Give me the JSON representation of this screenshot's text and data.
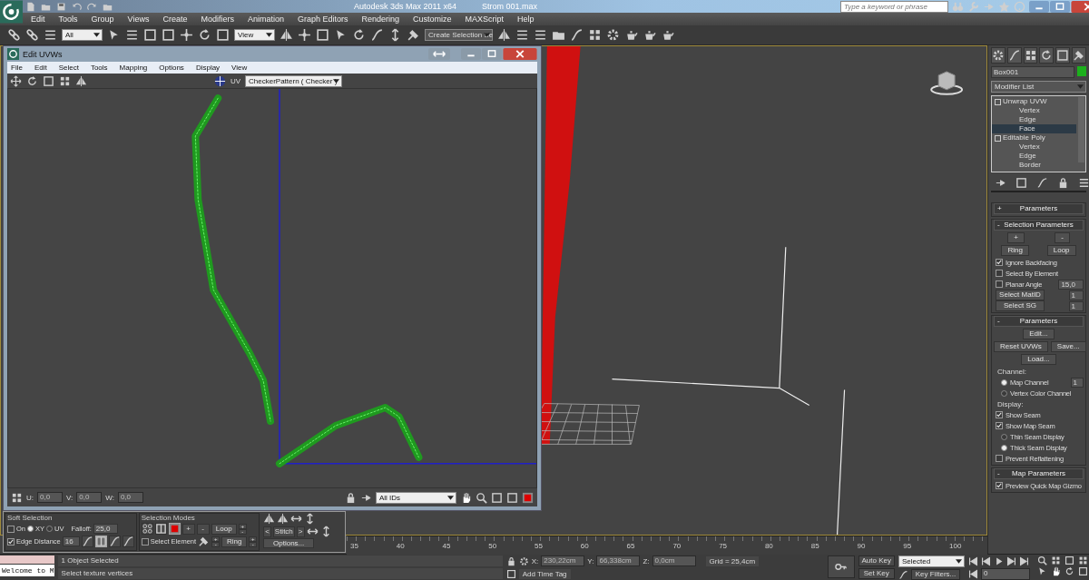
{
  "title_bar": {
    "app_title": "Autodesk 3ds Max  2011 x64",
    "file_name": "Strom 001.max",
    "search": {
      "placeholder": "Type a keyword or phrase"
    }
  },
  "menu": [
    "Edit",
    "Tools",
    "Group",
    "Views",
    "Create",
    "Modifiers",
    "Animation",
    "Graph Editors",
    "Rendering",
    "Customize",
    "MAXScript",
    "Help"
  ],
  "toolbar": {
    "selection_filter": "All",
    "reference_coord": "View",
    "named_selection": "Create Selection Se"
  },
  "uvw_editor": {
    "title": "Edit UVWs",
    "menu": [
      "File",
      "Edit",
      "Select",
      "Tools",
      "Mapping",
      "Options",
      "Display",
      "View"
    ],
    "uv_label": "UV",
    "texture": "CheckerPattern  ( Checker )",
    "coords": [
      {
        "label": "U:",
        "value": "0,0"
      },
      {
        "label": "V:",
        "value": "0,0"
      },
      {
        "label": "W:",
        "value": "0,0"
      }
    ],
    "id_filter": "All IDs"
  },
  "soft_selection": {
    "title": "Soft Selection",
    "on": {
      "label": "On",
      "checked": false
    },
    "axes": [
      {
        "label": "XY",
        "selected": true
      },
      {
        "label": "UV",
        "selected": false
      }
    ],
    "falloff_label": "Falloff:",
    "falloff": "25,0",
    "edge_distance": {
      "label": "Edge Distance",
      "checked": true
    },
    "edge_distance_value": "16",
    "curves": [
      {
        "selected": false
      },
      {
        "selected": true
      },
      {
        "selected": false
      },
      {
        "selected": false
      }
    ]
  },
  "selection_modes": {
    "title": "Selection Modes",
    "modes": [
      {
        "kind": "vertex",
        "selected": false
      },
      {
        "kind": "edge",
        "selected": false
      },
      {
        "kind": "face",
        "selected": true
      }
    ],
    "grow": "+",
    "shrink": "-",
    "select_element": {
      "label": "Select Element",
      "checked": false
    },
    "element_plus": "+",
    "element_minus": "-",
    "loop": {
      "label": "Loop",
      "plus": "+",
      "minus": "-"
    },
    "ring": {
      "label": "Ring",
      "plus": "+",
      "minus": "-"
    }
  },
  "stitch_tools": {
    "prev": "<",
    "label": "Stitch",
    "next": ">",
    "options": "Options..."
  },
  "timeline": {
    "ticks": [
      "35",
      "40",
      "45",
      "50",
      "55",
      "60",
      "65",
      "70",
      "75",
      "80",
      "85",
      "90",
      "95",
      "100"
    ]
  },
  "command_panel": {
    "object_name": "Box001",
    "modifier_list": "Modifier List",
    "stack": [
      {
        "label": "Unwrap UVW",
        "selected": false,
        "children": [
          {
            "label": "Vertex",
            "selected": false
          },
          {
            "label": "Edge",
            "selected": false
          },
          {
            "label": "Face",
            "selected": true
          }
        ]
      },
      {
        "label": "Editable Poly",
        "selected": false,
        "children": [
          {
            "label": "Vertex",
            "selected": false
          },
          {
            "label": "Edge",
            "selected": false
          },
          {
            "label": "Border",
            "selected": false
          }
        ]
      }
    ],
    "rollouts": [
      {
        "sign": "+",
        "title": "Parameters"
      },
      {
        "sign": "-",
        "title": "Selection Parameters",
        "rows": [
          {
            "kind": "buttons",
            "labels": [
              "+",
              "-"
            ]
          },
          {
            "kind": "buttons",
            "labels": [
              "Ring",
              "Loop"
            ]
          },
          {
            "kind": "check",
            "label": "Ignore Backfacing",
            "checked": true
          },
          {
            "kind": "check",
            "label": "Select By Element",
            "checked": false
          },
          {
            "kind": "check_spinner",
            "label": "Planar Angle",
            "checked": false,
            "value": "15,0"
          },
          {
            "kind": "button_spinner",
            "label": "Select MatID",
            "value": "1"
          },
          {
            "kind": "button_spinner",
            "label": "Select SG",
            "value": "1"
          }
        ]
      },
      {
        "sign": "-",
        "title": "Parameters",
        "rows": [
          {
            "kind": "buttons",
            "labels": [
              "Edit..."
            ]
          },
          {
            "kind": "buttons",
            "labels": [
              "Reset UVWs",
              "Save..."
            ]
          },
          {
            "kind": "buttons",
            "labels": [
              "Load..."
            ]
          },
          {
            "kind": "group",
            "label": "Channel:"
          },
          {
            "kind": "radio_spinner",
            "label": "Map Channel",
            "selected": true,
            "value": "1"
          },
          {
            "kind": "radio",
            "label": "Vertex Color Channel",
            "selected": false
          },
          {
            "kind": "group",
            "label": "Display:"
          },
          {
            "kind": "check",
            "label": "Show Seam",
            "checked": true
          },
          {
            "kind": "check",
            "label": "Show Map Seam",
            "checked": true
          },
          {
            "kind": "radio",
            "label": "Thin Seam Display",
            "selected": false
          },
          {
            "kind": "radio",
            "label": "Thick Seam Display",
            "selected": true
          },
          {
            "kind": "check",
            "label": "Prevent Reflattening",
            "checked": false
          }
        ]
      },
      {
        "sign": "-",
        "title": "Map Parameters",
        "rows": [
          {
            "kind": "check",
            "label": "Preview Quick Map Gizmo",
            "checked": true
          }
        ]
      }
    ]
  },
  "status_bar": {
    "script_listener": "Welcome to M",
    "prompt_line": "1 Object Selected",
    "status_text": "Select texture vertices",
    "coords": [
      {
        "label": "X:",
        "value": "230,22cm"
      },
      {
        "label": "Y:",
        "value": "66,338cm"
      },
      {
        "label": "Z:",
        "value": "0,0cm"
      }
    ],
    "grid": "Grid = 25,4cm",
    "time_tag": "Add Time Tag",
    "auto_key": "Auto Key",
    "set_key": "Set Key",
    "key_mode": "Selected",
    "key_filters": "Key Filters...",
    "frame": "0"
  }
}
